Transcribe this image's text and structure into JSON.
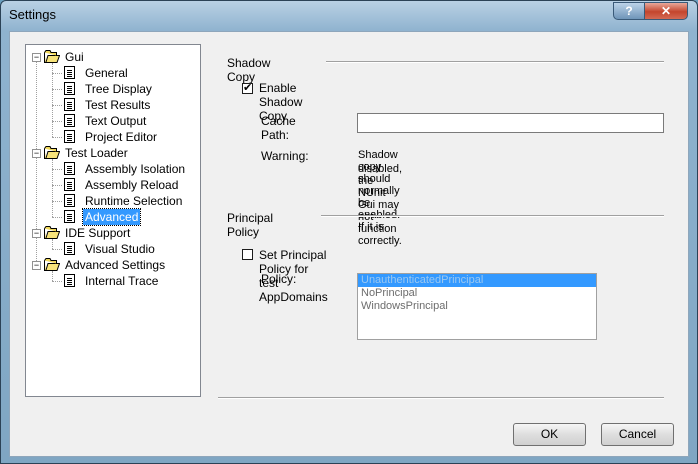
{
  "window": {
    "title": "Settings",
    "help_label": "?",
    "close_label": "✕"
  },
  "tree": {
    "nodes": [
      {
        "label": "Gui",
        "type": "folder",
        "expanded": true,
        "level": 0
      },
      {
        "label": "General",
        "type": "page",
        "level": 1
      },
      {
        "label": "Tree Display",
        "type": "page",
        "level": 1
      },
      {
        "label": "Test Results",
        "type": "page",
        "level": 1
      },
      {
        "label": "Text Output",
        "type": "page",
        "level": 1
      },
      {
        "label": "Project Editor",
        "type": "page",
        "level": 1
      },
      {
        "label": "Test Loader",
        "type": "folder",
        "expanded": true,
        "level": 0
      },
      {
        "label": "Assembly Isolation",
        "type": "page",
        "level": 1
      },
      {
        "label": "Assembly Reload",
        "type": "page",
        "level": 1
      },
      {
        "label": "Runtime Selection",
        "type": "page",
        "level": 1
      },
      {
        "label": "Advanced",
        "type": "page",
        "level": 1,
        "selected": true
      },
      {
        "label": "IDE Support",
        "type": "folder",
        "expanded": true,
        "level": 0
      },
      {
        "label": "Visual Studio",
        "type": "page",
        "level": 1
      },
      {
        "label": "Advanced Settings",
        "type": "folder",
        "expanded": true,
        "level": 0
      },
      {
        "label": "Internal Trace",
        "type": "page",
        "level": 1
      }
    ],
    "expander_glyph": "−"
  },
  "shadow_copy": {
    "title": "Shadow Copy",
    "enable_label": "Enable Shadow Copy",
    "enable_checked": true,
    "cache_path_label": "Cache Path:",
    "cache_path_value": "",
    "warning_label": "Warning:",
    "warning_line1": "Shadow copy should normally be enabled. If it is",
    "warning_line2": "disabled, the NUnit Gui may not function correctly."
  },
  "principal_policy": {
    "title": "Principal Policy",
    "set_label": "Set Principal Policy for test AppDomains",
    "set_checked": false,
    "policy_label": "Policy:",
    "options": [
      "UnauthenticatedPrincipal",
      "NoPrincipal",
      "WindowsPrincipal"
    ],
    "selected_index": 0
  },
  "buttons": {
    "ok": "OK",
    "cancel": "Cancel"
  },
  "check_glyph": "✔"
}
